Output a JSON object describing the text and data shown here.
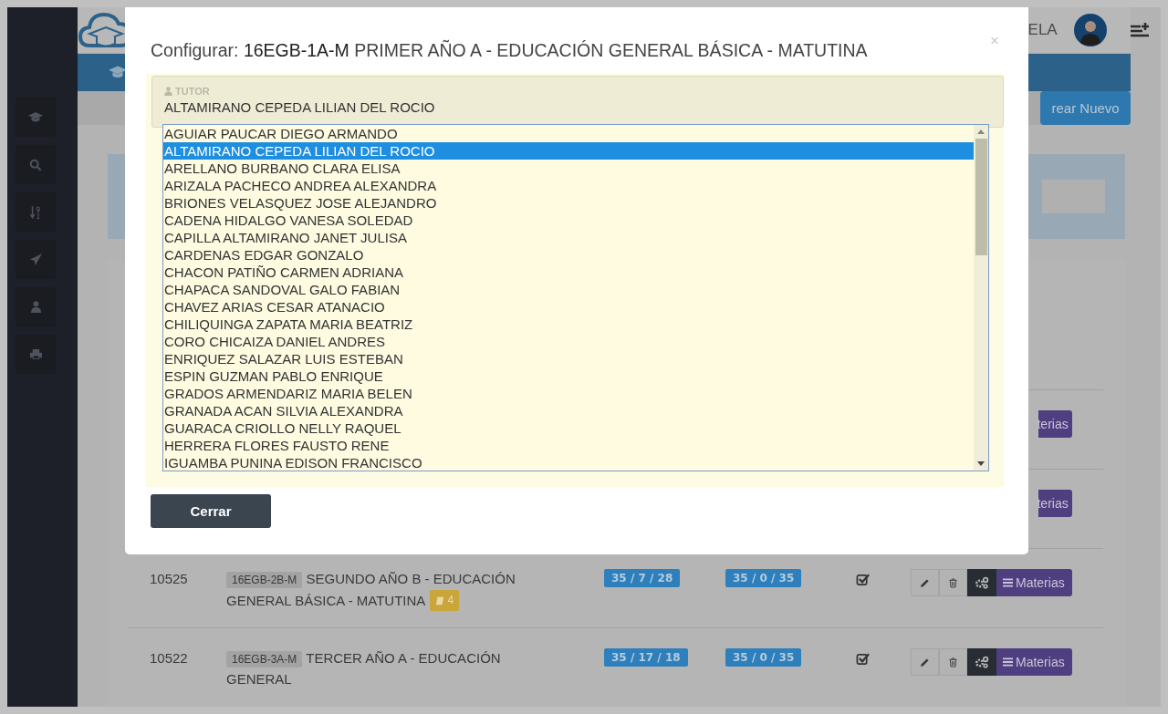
{
  "header": {
    "user_name": "ELA"
  },
  "toolbar": {
    "create_button": "rear Nuevo"
  },
  "table": {
    "rows": [
      {
        "actions_label": "terias"
      },
      {
        "actions_label": "terias"
      },
      {
        "id": "10525",
        "code": "16EGB-2B-M",
        "name": "SEGUNDO AÑO B - EDUCACIÓN GENERAL BÁSICA - MATUTINA",
        "subjects_count": "4",
        "column_3": "35 / 7 / 28",
        "column_4": "35 / 0 / 35",
        "checked": true,
        "actions_label": "Materias"
      },
      {
        "id": "10522",
        "code": "16EGB-3A-M",
        "name": "TERCER AÑO A - EDUCACIÓN GENERAL",
        "column_3": "35 / 17 / 18",
        "column_4": "35 / 0 / 35",
        "checked": true,
        "actions_label": "Materias"
      }
    ]
  },
  "modal": {
    "title": "Configurar: **16EGB-1A-M** PRIMER AÑO A - EDUCACIÓN GENERAL BÁSICA - MATUTINA",
    "close": "×",
    "tutor": {
      "label": "TUTOR",
      "value": "ALTAMIRANO CEPEDA LILIAN DEL ROCIO",
      "options": [
        {
          "label": "AGUIAR PAUCAR DIEGO ARMANDO",
          "selected": false
        },
        {
          "label": "ALTAMIRANO CEPEDA LILIAN DEL ROCIO",
          "selected": true
        },
        {
          "label": "ARELLANO BURBANO CLARA ELISA",
          "selected": false
        },
        {
          "label": "ARIZALA PACHECO ANDREA ALEXANDRA",
          "selected": false
        },
        {
          "label": "BRIONES VELASQUEZ JOSE ALEJANDRO",
          "selected": false
        },
        {
          "label": "CADENA HIDALGO VANESA SOLEDAD",
          "selected": false
        },
        {
          "label": "CAPILLA ALTAMIRANO JANET JULISA",
          "selected": false
        },
        {
          "label": "CARDENAS EDGAR GONZALO",
          "selected": false
        },
        {
          "label": "CHACON PATIÑO CARMEN ADRIANA",
          "selected": false
        },
        {
          "label": "CHAPACA SANDOVAL GALO FABIAN",
          "selected": false
        },
        {
          "label": "CHAVEZ ARIAS CESAR ATANACIO",
          "selected": false
        },
        {
          "label": "CHILIQUINGA ZAPATA MARIA BEATRIZ",
          "selected": false
        },
        {
          "label": "CORO CHICAIZA DANIEL ANDRES",
          "selected": false
        },
        {
          "label": "ENRIQUEZ SALAZAR LUIS ESTEBAN",
          "selected": false
        },
        {
          "label": "ESPIN GUZMAN PABLO ENRIQUE",
          "selected": false
        },
        {
          "label": "GRADOS ARMENDARIZ MARIA BELEN",
          "selected": false
        },
        {
          "label": "GRANADA ACAN SILVIA ALEXANDRA",
          "selected": false
        },
        {
          "label": "GUARACA CRIOLLO NELLY RAQUEL",
          "selected": false
        },
        {
          "label": "HERRERA FLORES FAUSTO RENE",
          "selected": false
        },
        {
          "label": "IGUAMBA PUNINA EDISON FRANCISCO",
          "selected": false
        }
      ]
    },
    "buttons": [
      "Cerrar"
    ]
  }
}
